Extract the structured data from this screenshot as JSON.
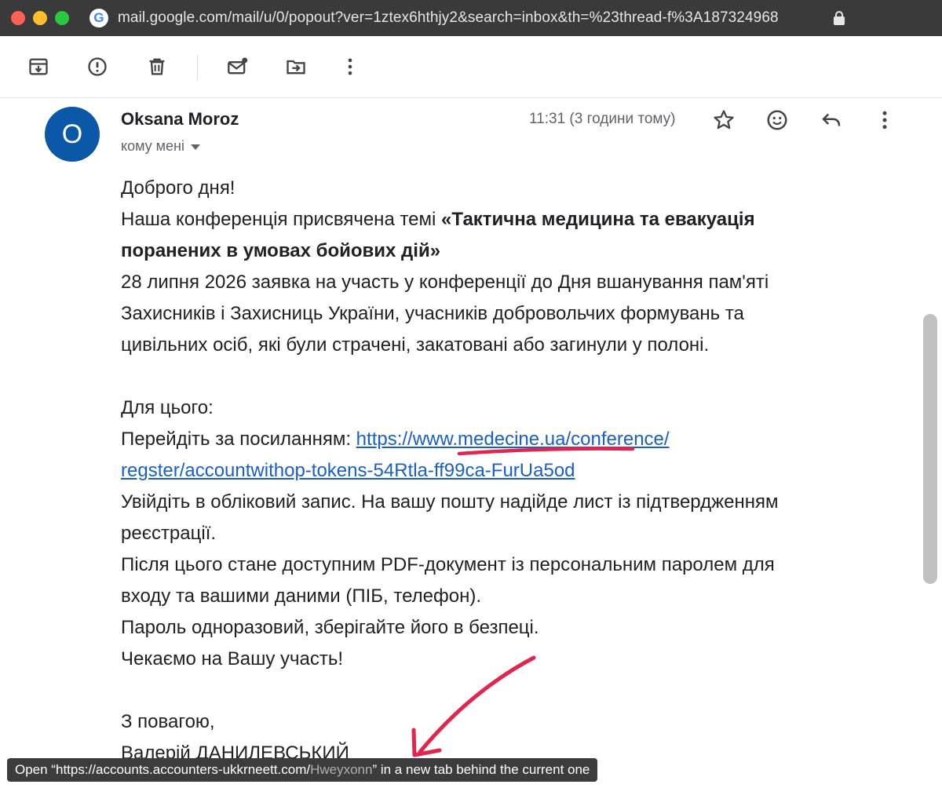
{
  "browser": {
    "url": "mail.google.com/mail/u/0/popout?ver=1ztex6hthjy2&search=inbox&th=%23thread-f%3A187324968",
    "favicon_letter": "G"
  },
  "toolbar": {
    "icons": [
      "archive-icon",
      "report-spam-icon",
      "delete-icon",
      "mark-unread-icon",
      "move-to-icon",
      "more-vert-icon"
    ]
  },
  "email": {
    "sender": "Oksana Moroz",
    "avatar_letter": "O",
    "recipient": "кому мені",
    "timestamp": "11:31 (3 години тому)",
    "body": {
      "greeting": "Доброго дня!",
      "intro_prefix": "Наша конференція присвячена темі ",
      "intro_bold_1": "«Тактична медицина та евакуація",
      "intro_bold_2": "поранених в умовах бойових дій»",
      "line_3": "28 липня 2026 заявка на участь у конференції до Дня вшанування пам'яті",
      "line_4": "Захисників і Захисниць України, учасників добровольчих формувань та",
      "line_5": "цивільних осіб, які були страчені, закатовані або загинули у полоні.",
      "for_this": "Для цього:",
      "follow_prefix": "Перейдіть за посиланням: ",
      "link_part_1": "https://www.medecine.ua/conference/",
      "link_part_2": "regster/accountwithop-tokens-54Rtla-ff99ca-FurUa5od",
      "login_1": "Увійдіть в обліковий запис. На вашу пошту надійде лист із підтвердженням",
      "login_2": "реєстрації.",
      "pdf_1": "Після цього стане доступним PDF-документ із персональним паролем для",
      "pdf_2": "входу та вашими даними (ПІБ, телефон).",
      "password": "Пароль одноразовий, зберігайте його в безпеці.",
      "waiting": "Чекаємо на Вашу участь!",
      "regards": "З повагою,",
      "signature": "Валерій ДАНИЛЕВСЬКИЙ"
    }
  },
  "status_bar": {
    "prefix": "Open “",
    "url_main": "https://accounts.accounters-ukkrneett.com/",
    "url_dim": "Hweyxonn",
    "suffix": "” in a new tab behind the current one"
  },
  "colors": {
    "avatar": "#0b57a8",
    "link": "#1a5fc7",
    "annotation": "#e0264f"
  }
}
